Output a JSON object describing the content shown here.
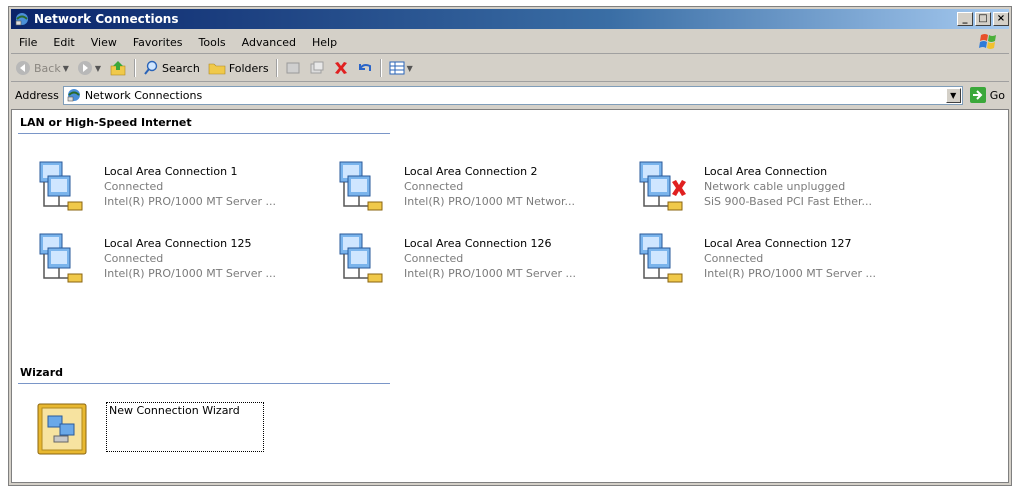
{
  "window": {
    "title": "Network Connections"
  },
  "menu": [
    {
      "label": "File"
    },
    {
      "label": "Edit"
    },
    {
      "label": "View"
    },
    {
      "label": "Favorites"
    },
    {
      "label": "Tools"
    },
    {
      "label": "Advanced"
    },
    {
      "label": "Help"
    }
  ],
  "toolbar": {
    "back_label": "Back",
    "search_label": "Search",
    "folders_label": "Folders"
  },
  "address": {
    "label": "Address",
    "value": "Network Connections",
    "go_label": "Go"
  },
  "groups": {
    "lan_header": "LAN or High-Speed Internet",
    "wizard_header": "Wizard"
  },
  "connections": [
    {
      "name": "Local Area Connection 1",
      "status": "Connected",
      "device": "Intel(R) PRO/1000 MT Server ...",
      "unplugged": false
    },
    {
      "name": "Local Area Connection 2",
      "status": "Connected",
      "device": "Intel(R) PRO/1000 MT Networ...",
      "unplugged": false
    },
    {
      "name": "Local Area Connection",
      "status": "Network cable unplugged",
      "device": "SiS 900-Based PCI Fast Ether...",
      "unplugged": true
    },
    {
      "name": "Local Area Connection 125",
      "status": "Connected",
      "device": "Intel(R) PRO/1000 MT Server ...",
      "unplugged": false
    },
    {
      "name": "Local Area Connection 126",
      "status": "Connected",
      "device": "Intel(R) PRO/1000 MT Server ...",
      "unplugged": false
    },
    {
      "name": "Local Area Connection 127",
      "status": "Connected",
      "device": "Intel(R) PRO/1000 MT Server ...",
      "unplugged": false
    }
  ],
  "wizard": {
    "label": "New Connection Wizard"
  },
  "colors": {
    "title_bar": "#0a246a",
    "group_line": "#7a96c8",
    "status_text": "#7b7b7b",
    "error_x": "#e02020"
  },
  "icons": {
    "title": "network-connections-icon",
    "connection": "network-computers-icon",
    "unplugged": "red-x-icon",
    "wizard": "new-connection-wizard-icon"
  }
}
